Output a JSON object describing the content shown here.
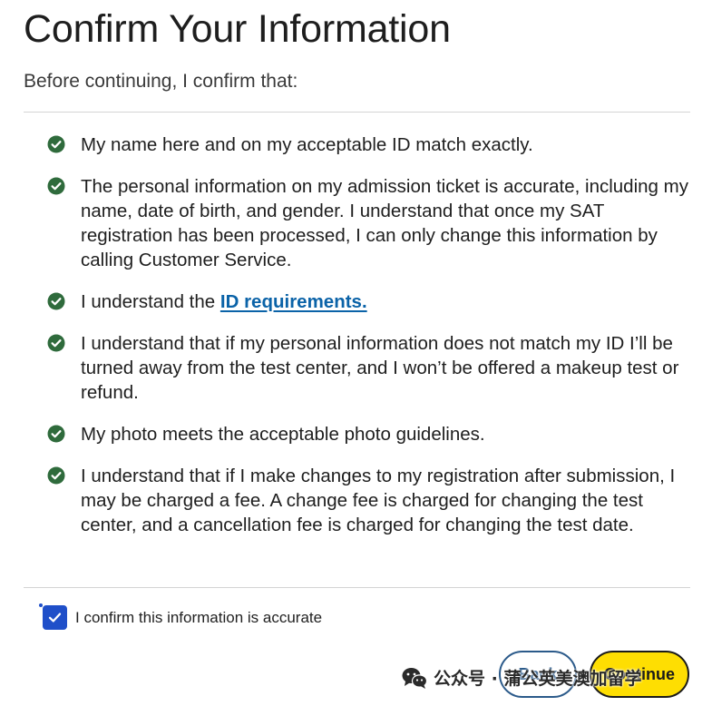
{
  "page": {
    "title": "Confirm Your Information",
    "subtitle": "Before continuing, I confirm that:"
  },
  "confirmations": {
    "item1": "My name here and on my acceptable ID match exactly.",
    "item2": "The personal information on my admission ticket is accurate, including my name, date of birth, and gender. I understand that once my SAT registration has been processed, I can only change this information by calling Customer Service.",
    "item3_prefix": "I understand the ",
    "item3_link": "ID requirements.",
    "item4": "I understand that if my personal information does not match my ID I’ll be turned away from the test center, and I won’t be offered a makeup test or refund.",
    "item5": "My photo meets the acceptable photo guidelines.",
    "item6": "I understand that if I make changes to my registration after submission, I may be charged a fee. A change fee is charged for changing the test center, and a cancellation fee is charged for changing the test date."
  },
  "confirm_checkbox": {
    "checked": true,
    "label": "I confirm this information is accurate"
  },
  "buttons": {
    "back_label": "Back",
    "continue_label": "Continue"
  },
  "watermark": {
    "text": "公众号 · 蒲公英美澳加留学"
  },
  "icons": {
    "check": "check-circle-icon",
    "checkbox_mark": "checkmark-icon",
    "wechat": "wechat-icon"
  },
  "colors": {
    "check_green": "#2f6b3c",
    "link_blue": "#0b63a8",
    "checkbox_blue": "#1f4fc9",
    "continue_yellow": "#fede02",
    "back_outline": "#2b5a8a"
  }
}
